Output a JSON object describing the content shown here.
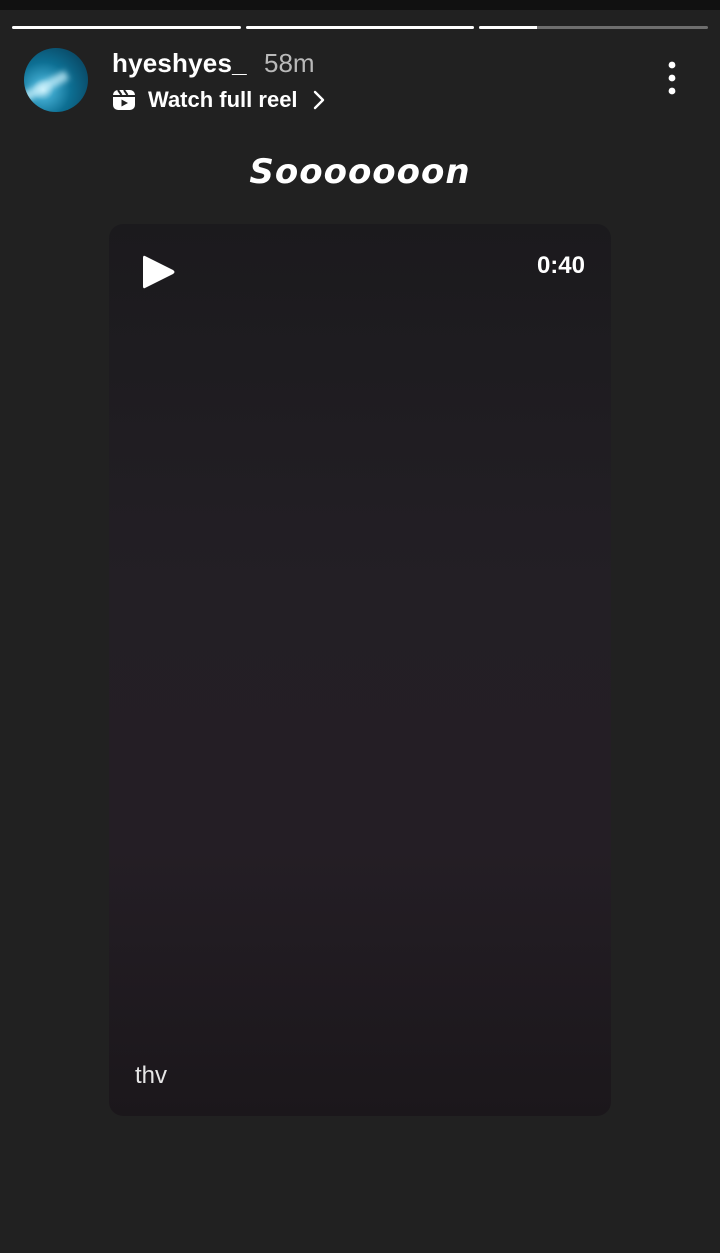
{
  "story": {
    "progress": [
      1.0,
      1.0,
      0.25
    ],
    "username": "hyeshyes_",
    "time": "58m",
    "reel_link_label": "Watch full reel",
    "caption": "Sooooooon"
  },
  "video": {
    "duration": "0:40",
    "author": "thv"
  },
  "icons": {
    "reel": "reels-icon",
    "chevron": "chevron-right-icon",
    "more": "more-vertical-icon",
    "play": "play-icon"
  }
}
